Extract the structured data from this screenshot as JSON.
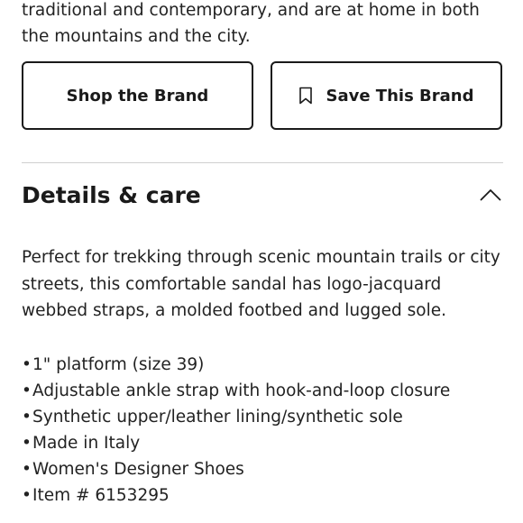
{
  "intro": {
    "text": "traditional and contemporary, and are at home in both the mountains and the city."
  },
  "actions": {
    "shop_label": "Shop the Brand",
    "save_label": "Save This Brand",
    "save_icon": "bookmark-icon"
  },
  "details": {
    "title": "Details & care",
    "toggle_icon": "chevron-up-icon",
    "expanded": true,
    "description": "Perfect for trekking through scenic mountain trails or city streets, this comfortable sandal has logo-jacquard webbed straps, a molded footbed and lugged sole.",
    "bullets": [
      "1\" platform (size 39)",
      "Adjustable ankle strap with hook-and-loop closure",
      "Synthetic upper/leather lining/synthetic sole",
      "Made in Italy",
      "Women's Designer Shoes",
      "Item # 6153295"
    ]
  }
}
